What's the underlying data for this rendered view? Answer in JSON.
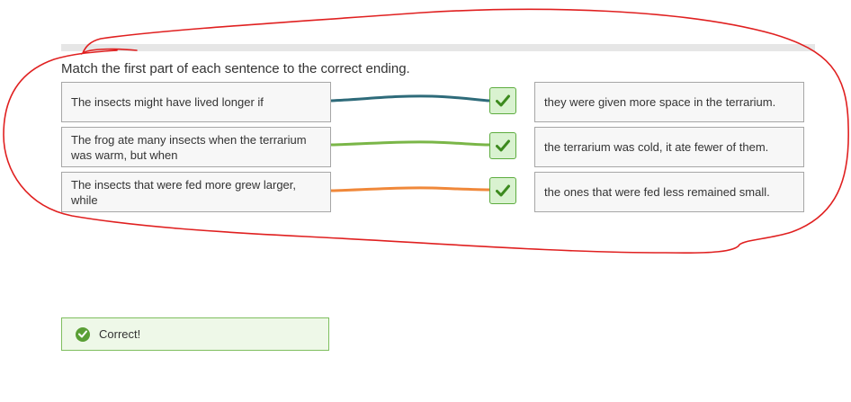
{
  "question": {
    "prompt": "Match the first part of each sentence to the correct ending."
  },
  "pairs": [
    {
      "left": "The insects might have lived longer if",
      "right": "they were given more space in the terrarium.",
      "connector_color": "#2e6b7a",
      "status": "correct"
    },
    {
      "left": "The frog ate many insects when the terrarium was warm, but when",
      "right": "the terrarium was cold, it ate fewer of them.",
      "connector_color": "#7ab648",
      "status": "correct"
    },
    {
      "left": "The insects that were fed more grew larger, while",
      "right": "the ones that were fed less remained small.",
      "connector_color": "#f0883a",
      "status": "correct"
    }
  ],
  "feedback": {
    "text": "Correct!",
    "icon": "check-circle-icon",
    "color": "#5a9f35"
  },
  "colors": {
    "check_border": "#5dac3f",
    "check_fill": "#d9f2d0",
    "annotation": "#e02020"
  }
}
